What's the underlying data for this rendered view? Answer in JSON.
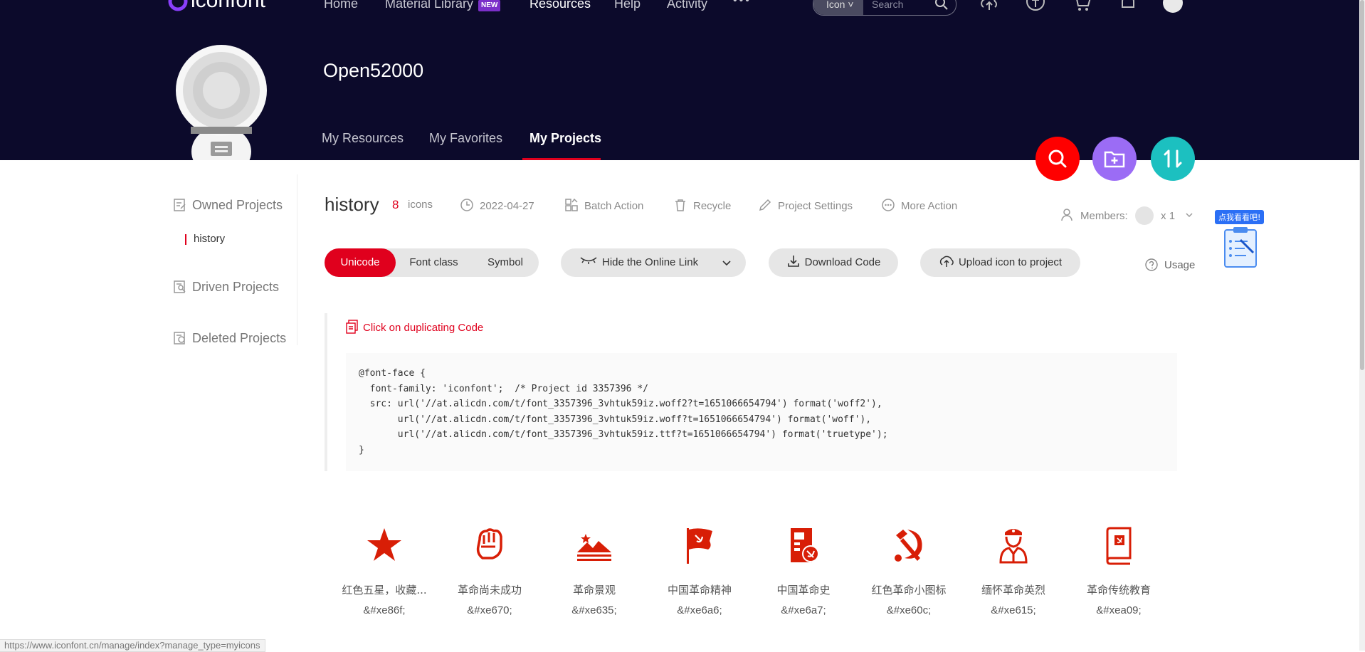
{
  "header": {
    "logo_text": "iconfont",
    "nav": [
      "Home",
      "Material Library",
      "Resources",
      "Help",
      "Activity"
    ],
    "new_badge": "NEW",
    "more_label": "•••",
    "search": {
      "type_label": "Icon",
      "placeholder": "Search"
    },
    "notification_count": ""
  },
  "profile": {
    "name": "Open52000",
    "tabs": [
      "My Resources",
      "My Favorites",
      "My Projects"
    ],
    "active_tab": "My Projects"
  },
  "sidebar": {
    "owned": "Owned Projects",
    "current_project": "history",
    "driven": "Driven Projects",
    "deleted": "Deleted Projects"
  },
  "toolbar": {
    "project_name": "history",
    "icon_count": "8",
    "icon_unit": "icons",
    "date": "2022-04-27",
    "batch_action": "Batch Action",
    "recycle": "Recycle",
    "project_settings": "Project Settings",
    "more_action": "More Action",
    "members_label": "Members:",
    "members_count": "x 1"
  },
  "code_options": {
    "tabs": [
      "Unicode",
      "Font class",
      "Symbol"
    ],
    "active": "Unicode",
    "hide_link": "Hide the Online Link",
    "download": "Download Code",
    "upload": "Upload icon to project",
    "usage": "Usage",
    "promo_bubble": "点我看看吧!"
  },
  "code": {
    "copy_hint": "Click on duplicating Code",
    "snippet": "@font-face {\n  font-family: 'iconfont';  /* Project id 3357396 */\n  src: url('//at.alicdn.com/t/font_3357396_3vhtuk59iz.woff2?t=1651066654794') format('woff2'),\n       url('//at.alicdn.com/t/font_3357396_3vhtuk59iz.woff?t=1651066654794') format('woff'),\n       url('//at.alicdn.com/t/font_3357396_3vhtuk59iz.ttf?t=1651066654794') format('truetype');\n}"
  },
  "icons": [
    {
      "name": "红色五星，收藏...",
      "code": "&#xe86f;",
      "icon": "star-icon"
    },
    {
      "name": "革命尚未成功",
      "code": "&#xe670;",
      "icon": "fist-icon"
    },
    {
      "name": "革命景观",
      "code": "&#xe635;",
      "icon": "landscape-icon"
    },
    {
      "name": "中国革命精神",
      "code": "&#xe6a6;",
      "icon": "flag-icon"
    },
    {
      "name": "中国革命史",
      "code": "&#xe6a7;",
      "icon": "history-doc-icon"
    },
    {
      "name": "红色革命小图标",
      "code": "&#xe60c;",
      "icon": "hammer-sickle-icon"
    },
    {
      "name": "缅怀革命英烈",
      "code": "&#xe615;",
      "icon": "soldier-icon"
    },
    {
      "name": "革命传统教育",
      "code": "&#xea09;",
      "icon": "book-icon"
    }
  ],
  "statusbar_url": "https://www.iconfont.cn/manage/index?manage_type=myicons",
  "colors": {
    "brand_red": "#e0001d",
    "header_bg": "#0c0a2b",
    "fab_search": "#ff0000",
    "fab_folder": "#9b6cf5",
    "fab_sort": "#1cc0c0",
    "icon_red": "#d81e06"
  }
}
